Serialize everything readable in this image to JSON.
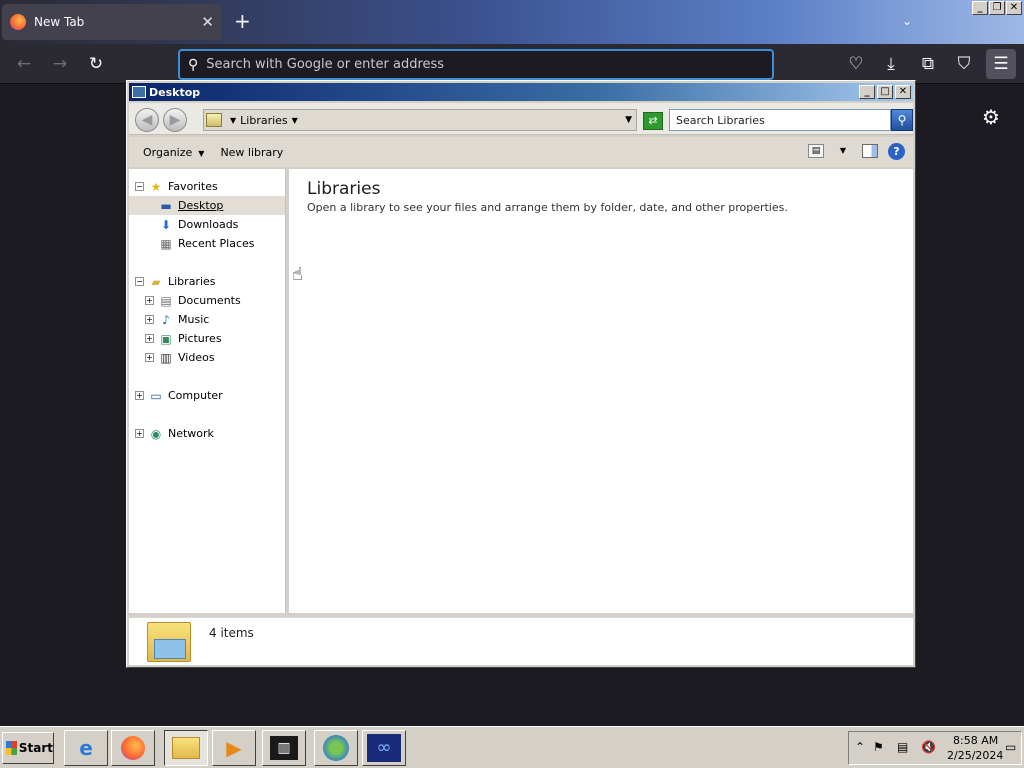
{
  "browser": {
    "tab": {
      "title": "New Tab"
    },
    "urlbar": {
      "placeholder": "Search with Google or enter address"
    }
  },
  "explorer": {
    "title": "Desktop",
    "address": {
      "crumb": "Libraries"
    },
    "search": {
      "placeholder": "Search Libraries"
    },
    "toolbar": {
      "organize": "Organize",
      "new_library": "New library"
    },
    "nav": {
      "favorites": "Favorites",
      "desktop": "Desktop",
      "downloads": "Downloads",
      "recent_places": "Recent Places",
      "libraries": "Libraries",
      "documents": "Documents",
      "music": "Music",
      "pictures": "Pictures",
      "videos": "Videos",
      "computer": "Computer",
      "network": "Network"
    },
    "content": {
      "title": "Libraries",
      "description": "Open a library to see your files and arrange them by folder, date, and other properties."
    },
    "status": {
      "count": "4 items"
    }
  },
  "taskbar": {
    "start_label": "Start",
    "clock_time": "8:58 AM",
    "clock_date": "2/25/2024"
  }
}
